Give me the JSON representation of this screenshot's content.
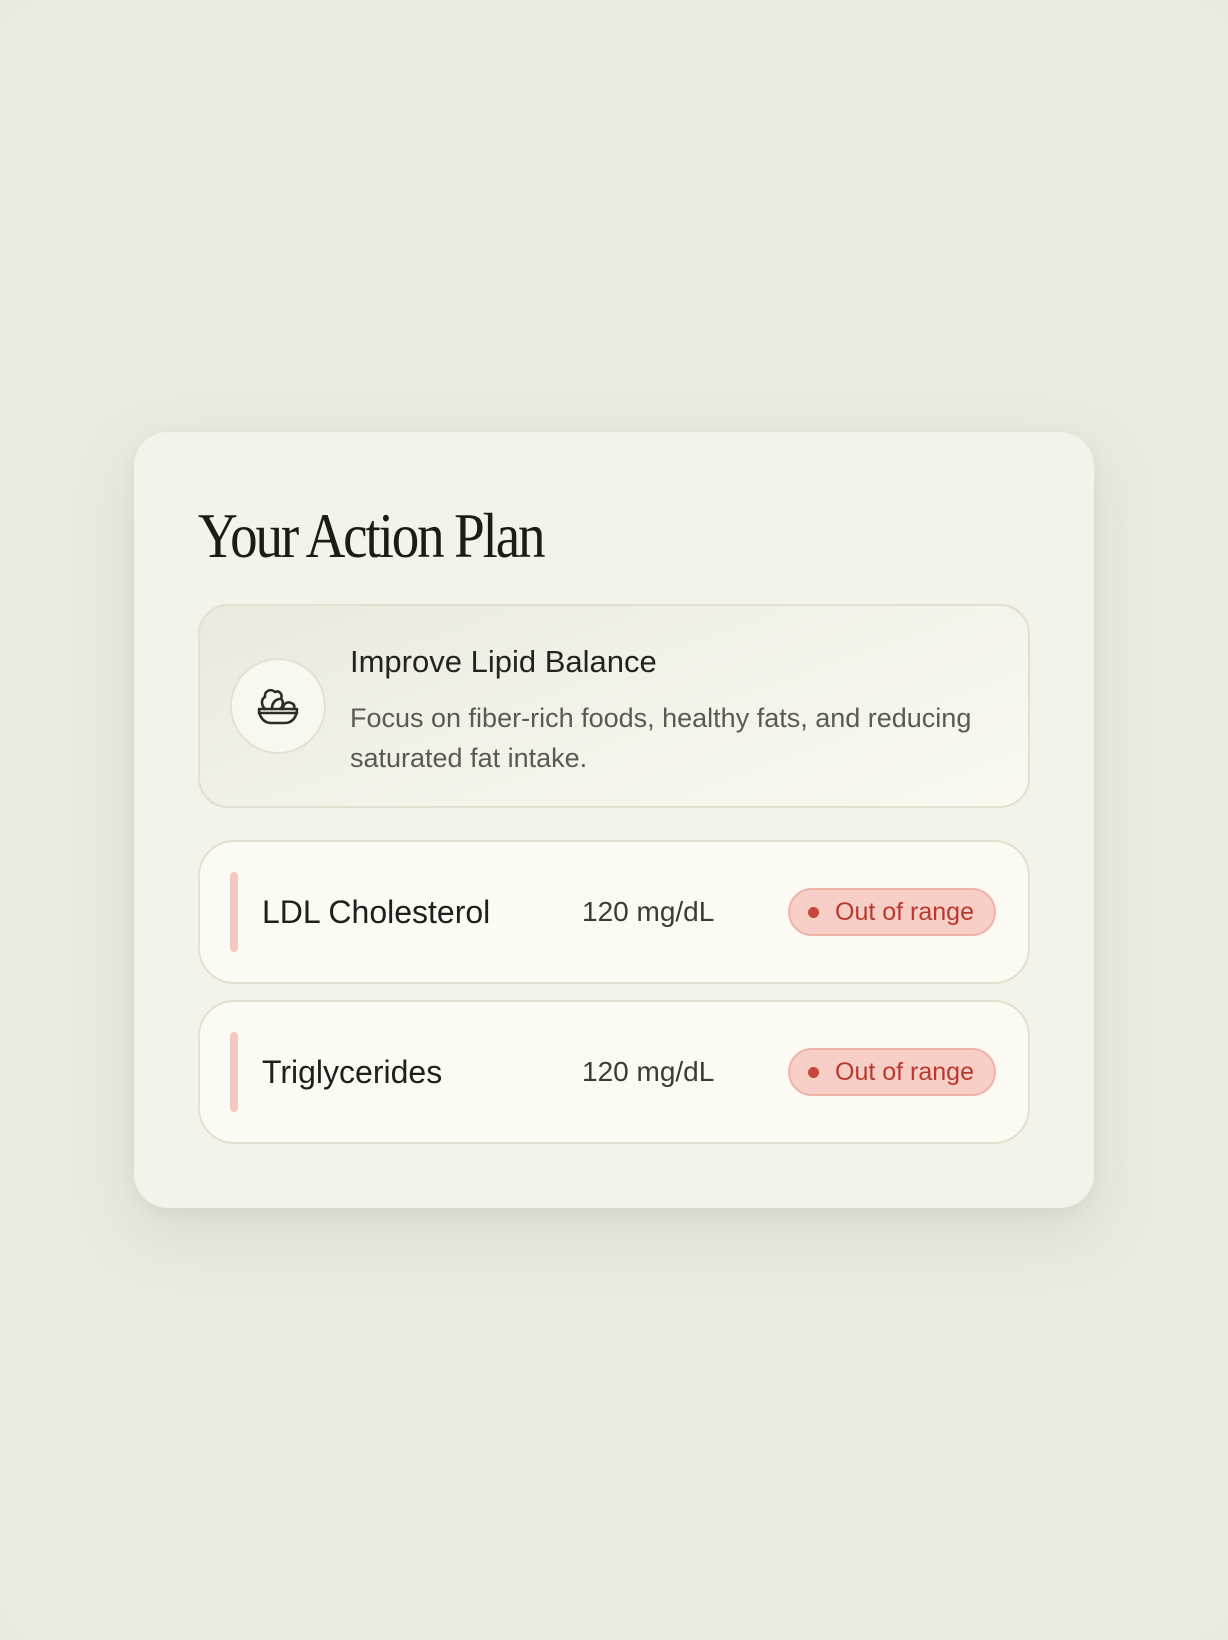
{
  "card": {
    "title": "Your Action Plan"
  },
  "plan": {
    "icon": "food-bowl-icon",
    "title": "Improve Lipid Balance",
    "description": "Focus on fiber-rich foods, healthy fats, and reducing saturated fat intake."
  },
  "metrics": [
    {
      "name": "LDL Cholesterol",
      "value": "120 mg/dL",
      "status": "Out of range"
    },
    {
      "name": "Triglycerides",
      "value": "120 mg/dL",
      "status": "Out of range"
    }
  ],
  "colors": {
    "background": "#eaeadf",
    "card": "#f4f3e9",
    "status_bg": "#f8cfc7",
    "status_text": "#b8392d",
    "accent_bar": "#f3c8c2"
  }
}
